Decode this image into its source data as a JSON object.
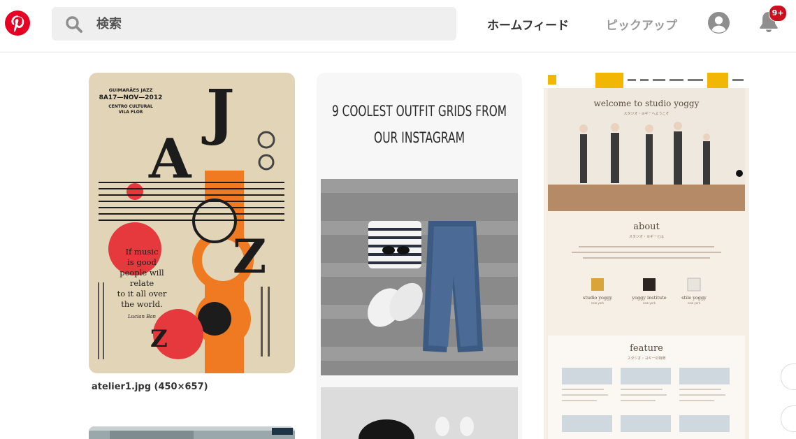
{
  "header": {
    "search": {
      "placeholder": "検索",
      "value": ""
    },
    "nav": {
      "home": "ホームフィード",
      "pickup": "ピックアップ"
    },
    "notifications": {
      "count": "9+"
    }
  },
  "pins": [
    {
      "name": "jazz-poster",
      "caption": "atelier1.jpg (450×657)",
      "poster": {
        "event": "GUIMARÃES JAZZ",
        "dates": "8A17—NOV—2012",
        "venue_line1": "CENTRO CULTURAL",
        "venue_line2": "VILA FLOR",
        "quote_lines": [
          "If music",
          "is good",
          "people will",
          "relate",
          "to it all over",
          "the world."
        ],
        "quote_author": "Lucian Ban",
        "letters": [
          "J",
          "A",
          "Z",
          "Z"
        ]
      }
    },
    {
      "name": "outfit-grids",
      "headline_line1": "9 COOLEST OUTFIT GRIDS FROM",
      "headline_line2": "OUR INSTAGRAM"
    },
    {
      "name": "studio-yoggy",
      "welcome": "welcome to studio yoggy",
      "welcome_sub": "スタジオ・ヨギーへようこそ",
      "about": "about",
      "about_sub": "スタジオ・ヨギーとは",
      "studios": [
        "studio yoggy",
        "yoggy institute",
        "stile yoggy"
      ],
      "studios_sub": [
        "new york",
        "new york",
        "new york"
      ],
      "feature": "feature",
      "feature_sub": "スタジオ・ヨギーの特徴"
    }
  ],
  "colors": {
    "brand": "#e60023",
    "badge": "#cc0f1f",
    "poster_bg": "#e2d4b6",
    "poster_orange": "#f07a22",
    "poster_red": "#e5393e"
  },
  "icons": [
    "pinterest-logo-icon",
    "search-icon",
    "profile-icon",
    "bell-icon"
  ]
}
